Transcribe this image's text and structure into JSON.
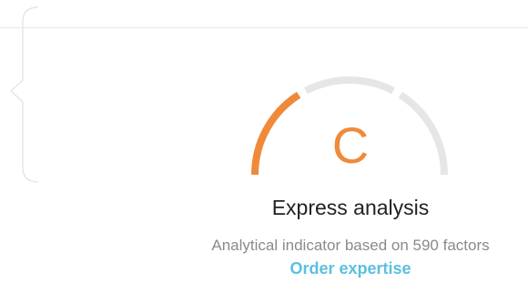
{
  "rating": {
    "grade": "C",
    "fill_fraction": 0.33,
    "active_color": "#ef8a3a",
    "inactive_color": "#e6e6e6"
  },
  "analysis": {
    "title": "Express analysis",
    "subtitle": "Analytical indicator based on 590 factors",
    "cta_label": "Order expertise"
  }
}
